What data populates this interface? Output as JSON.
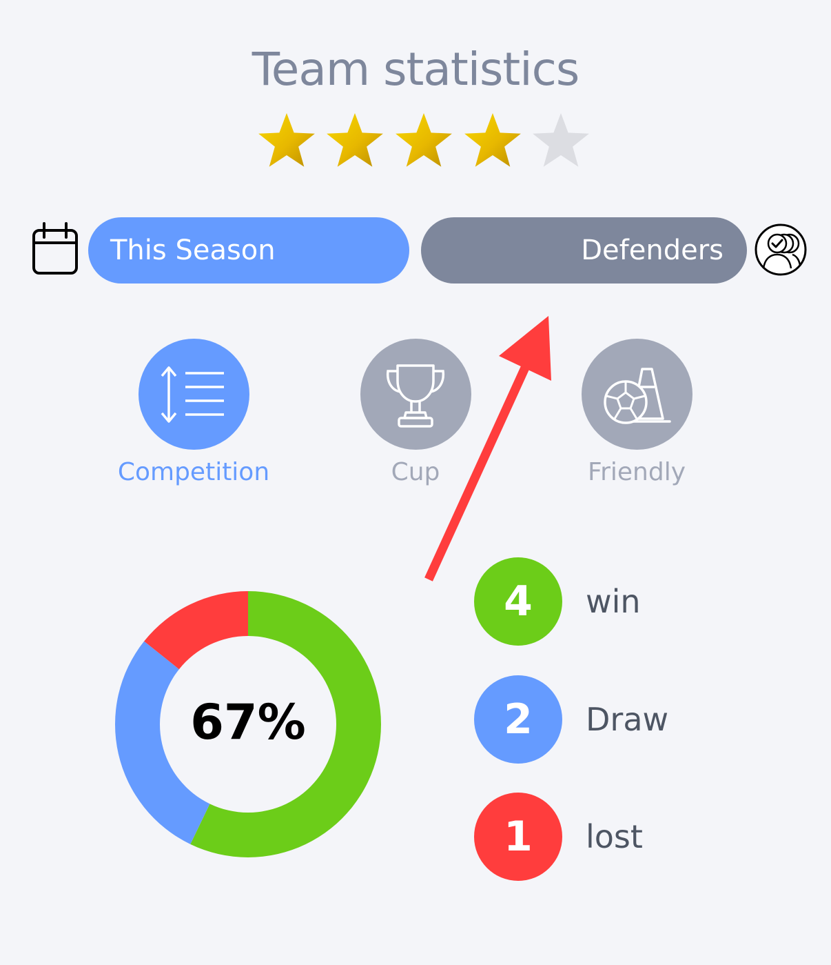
{
  "header": {
    "title": "Team statistics",
    "rating": {
      "value": 4,
      "max": 5
    }
  },
  "filters": {
    "season_label": "This Season",
    "position_label": "Defenders",
    "calendar_icon": "calendar-icon",
    "players_icon": "players-check-icon"
  },
  "modes": [
    {
      "label": "Competition",
      "icon": "sort-list-icon",
      "selected": true
    },
    {
      "label": "Cup",
      "icon": "trophy-icon",
      "selected": false
    },
    {
      "label": "Friendly",
      "icon": "ball-cone-icon",
      "selected": false
    }
  ],
  "stats": {
    "percent_label": "67%",
    "items": [
      {
        "count": "4",
        "label": "win",
        "value": 4,
        "color": "#6ccd19"
      },
      {
        "count": "2",
        "label": "Draw",
        "value": 2,
        "color": "#659bff"
      },
      {
        "count": "1",
        "label": "lost",
        "value": 1,
        "color": "#ff3d3d"
      }
    ]
  },
  "colors": {
    "accent": "#659bff",
    "inactive": "#a2a8b8",
    "pill_inactive": "#7e879c",
    "star_on": "#f2c500",
    "star_off": "#dcdde2",
    "annotation_arrow": "#ff3d3d"
  }
}
